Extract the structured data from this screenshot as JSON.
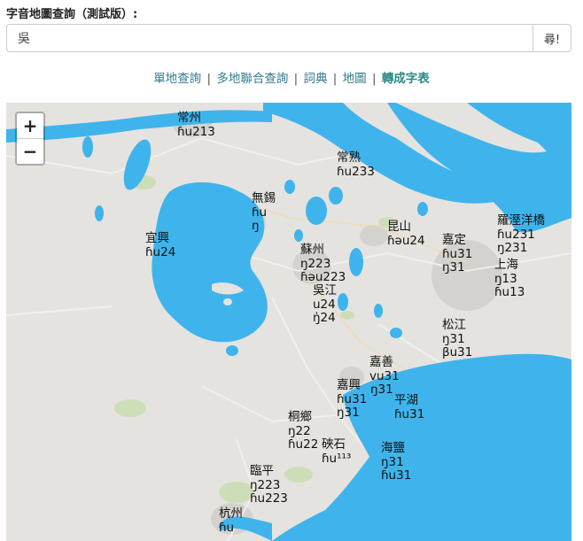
{
  "header": {
    "title": "字音地圖查詢（測試版）:"
  },
  "search": {
    "value": "吳",
    "button_label": "尋!"
  },
  "nav": {
    "items": [
      {
        "label": "單地查詢"
      },
      {
        "label": "多地聯合查詢"
      },
      {
        "label": "詞典"
      },
      {
        "label": "地圖"
      },
      {
        "label": "轉成字表"
      }
    ],
    "separator": "|"
  },
  "map": {
    "zoom_in": "+",
    "zoom_out": "−",
    "places": [
      {
        "name": "常州",
        "readings": [
          "ɦu213"
        ]
      },
      {
        "name": "常熟",
        "readings": [
          "ɦu233"
        ]
      },
      {
        "name": "無錫",
        "readings": [
          "ɦu",
          "ŋ"
        ]
      },
      {
        "name": "宜興",
        "readings": [
          "ɦu24"
        ]
      },
      {
        "name": "昆山",
        "readings": [
          "ɦəu24"
        ]
      },
      {
        "name": "羅溼洋橋",
        "readings": [
          "ɦu231",
          "ŋ231"
        ]
      },
      {
        "name": "嘉定",
        "readings": [
          "ɦu31",
          "ŋ31"
        ]
      },
      {
        "name": "上海",
        "readings": [
          "ŋ13",
          "ɦu13"
        ]
      },
      {
        "name": "蘇州",
        "readings": [
          "ŋ223",
          "ɦəu223"
        ]
      },
      {
        "name": "吳江",
        "readings": [
          "u24",
          "ŋ̍24"
        ]
      },
      {
        "name": "松江",
        "readings": [
          "ŋ31",
          "βu31"
        ]
      },
      {
        "name": "嘉善",
        "readings": [
          "vu31",
          "ŋ31"
        ]
      },
      {
        "name": "嘉興",
        "readings": [
          "ɦu31",
          "ŋ31"
        ]
      },
      {
        "name": "平湖",
        "readings": [
          "ɦu31"
        ]
      },
      {
        "name": "桐鄉",
        "readings": [
          "ŋ22",
          "ɦu22"
        ]
      },
      {
        "name": "硤石",
        "readings": [
          "ɦu¹¹³"
        ]
      },
      {
        "name": "海鹽",
        "readings": [
          "ŋ31",
          "ɦu31"
        ]
      },
      {
        "name": "臨平",
        "readings": [
          "ŋ223",
          "ɦu223"
        ]
      },
      {
        "name": "杭州",
        "readings": [
          "ɦu"
        ]
      }
    ]
  }
}
